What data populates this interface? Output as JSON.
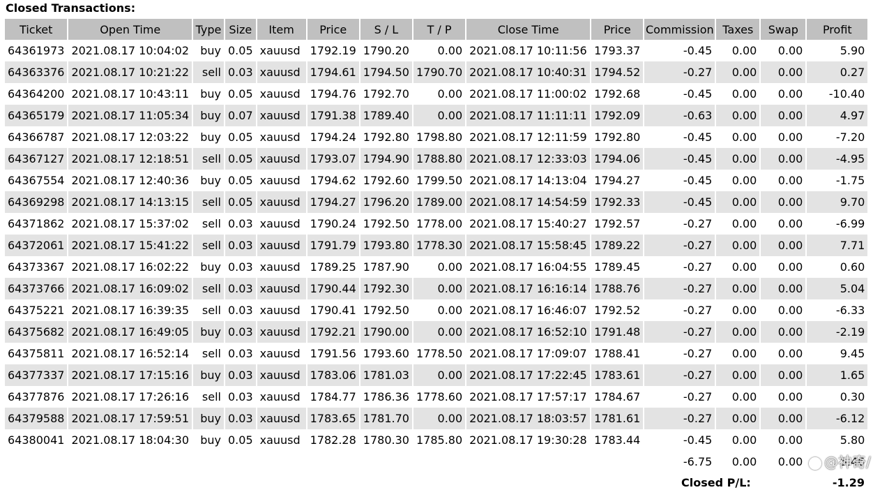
{
  "section_title": "Closed Transactions:",
  "columns": [
    "Ticket",
    "Open Time",
    "Type",
    "Size",
    "Item",
    "Price",
    "S / L",
    "T / P",
    "Close Time",
    "Price",
    "Commission",
    "Taxes",
    "Swap",
    "Profit"
  ],
  "rows": [
    [
      "64361973",
      "2021.08.17 10:04:02",
      "buy",
      "0.05",
      "xauusd",
      "1792.19",
      "1790.20",
      "0.00",
      "2021.08.17 10:11:56",
      "1793.37",
      "-0.45",
      "0.00",
      "0.00",
      "5.90"
    ],
    [
      "64363376",
      "2021.08.17 10:21:22",
      "sell",
      "0.03",
      "xauusd",
      "1794.61",
      "1794.50",
      "1790.70",
      "2021.08.17 10:40:31",
      "1794.52",
      "-0.27",
      "0.00",
      "0.00",
      "0.27"
    ],
    [
      "64364200",
      "2021.08.17 10:43:11",
      "buy",
      "0.05",
      "xauusd",
      "1794.76",
      "1792.70",
      "0.00",
      "2021.08.17 11:00:02",
      "1792.68",
      "-0.45",
      "0.00",
      "0.00",
      "-10.40"
    ],
    [
      "64365179",
      "2021.08.17 11:05:34",
      "buy",
      "0.07",
      "xauusd",
      "1791.38",
      "1789.40",
      "0.00",
      "2021.08.17 11:11:11",
      "1792.09",
      "-0.63",
      "0.00",
      "0.00",
      "4.97"
    ],
    [
      "64366787",
      "2021.08.17 12:03:22",
      "buy",
      "0.05",
      "xauusd",
      "1794.24",
      "1792.80",
      "1798.80",
      "2021.08.17 12:11:59",
      "1792.80",
      "-0.45",
      "0.00",
      "0.00",
      "-7.20"
    ],
    [
      "64367127",
      "2021.08.17 12:18:51",
      "sell",
      "0.05",
      "xauusd",
      "1793.07",
      "1794.90",
      "1788.80",
      "2021.08.17 12:33:03",
      "1794.06",
      "-0.45",
      "0.00",
      "0.00",
      "-4.95"
    ],
    [
      "64367554",
      "2021.08.17 12:40:36",
      "buy",
      "0.05",
      "xauusd",
      "1794.62",
      "1792.60",
      "1799.50",
      "2021.08.17 14:13:04",
      "1794.27",
      "-0.45",
      "0.00",
      "0.00",
      "-1.75"
    ],
    [
      "64369298",
      "2021.08.17 14:13:15",
      "sell",
      "0.05",
      "xauusd",
      "1794.27",
      "1796.20",
      "1789.00",
      "2021.08.17 14:54:59",
      "1792.33",
      "-0.45",
      "0.00",
      "0.00",
      "9.70"
    ],
    [
      "64371862",
      "2021.08.17 15:37:02",
      "sell",
      "0.03",
      "xauusd",
      "1790.24",
      "1792.50",
      "1778.00",
      "2021.08.17 15:40:27",
      "1792.57",
      "-0.27",
      "0.00",
      "0.00",
      "-6.99"
    ],
    [
      "64372061",
      "2021.08.17 15:41:22",
      "sell",
      "0.03",
      "xauusd",
      "1791.79",
      "1793.80",
      "1778.30",
      "2021.08.17 15:58:45",
      "1789.22",
      "-0.27",
      "0.00",
      "0.00",
      "7.71"
    ],
    [
      "64373367",
      "2021.08.17 16:02:22",
      "buy",
      "0.03",
      "xauusd",
      "1789.25",
      "1787.90",
      "0.00",
      "2021.08.17 16:04:55",
      "1789.45",
      "-0.27",
      "0.00",
      "0.00",
      "0.60"
    ],
    [
      "64373766",
      "2021.08.17 16:09:02",
      "sell",
      "0.03",
      "xauusd",
      "1790.44",
      "1792.30",
      "0.00",
      "2021.08.17 16:16:14",
      "1788.76",
      "-0.27",
      "0.00",
      "0.00",
      "5.04"
    ],
    [
      "64375221",
      "2021.08.17 16:39:35",
      "sell",
      "0.03",
      "xauusd",
      "1790.41",
      "1792.50",
      "0.00",
      "2021.08.17 16:46:07",
      "1792.52",
      "-0.27",
      "0.00",
      "0.00",
      "-6.33"
    ],
    [
      "64375682",
      "2021.08.17 16:49:05",
      "buy",
      "0.03",
      "xauusd",
      "1792.21",
      "1790.00",
      "0.00",
      "2021.08.17 16:52:10",
      "1791.48",
      "-0.27",
      "0.00",
      "0.00",
      "-2.19"
    ],
    [
      "64375811",
      "2021.08.17 16:52:14",
      "sell",
      "0.03",
      "xauusd",
      "1791.56",
      "1793.60",
      "1778.50",
      "2021.08.17 17:09:07",
      "1788.41",
      "-0.27",
      "0.00",
      "0.00",
      "9.45"
    ],
    [
      "64377337",
      "2021.08.17 17:15:16",
      "buy",
      "0.03",
      "xauusd",
      "1783.06",
      "1781.03",
      "0.00",
      "2021.08.17 17:22:45",
      "1783.61",
      "-0.27",
      "0.00",
      "0.00",
      "1.65"
    ],
    [
      "64377876",
      "2021.08.17 17:26:16",
      "sell",
      "0.03",
      "xauusd",
      "1784.77",
      "1786.36",
      "1778.60",
      "2021.08.17 17:57:17",
      "1784.67",
      "-0.27",
      "0.00",
      "0.00",
      "0.30"
    ],
    [
      "64379588",
      "2021.08.17 17:59:51",
      "buy",
      "0.03",
      "xauusd",
      "1783.65",
      "1781.70",
      "0.00",
      "2021.08.17 18:03:57",
      "1781.61",
      "-0.27",
      "0.00",
      "0.00",
      "-6.12"
    ],
    [
      "64380041",
      "2021.08.17 18:04:30",
      "buy",
      "0.05",
      "xauusd",
      "1782.28",
      "1780.30",
      "1785.80",
      "2021.08.17 19:30:28",
      "1783.44",
      "-0.45",
      "0.00",
      "0.00",
      "5.80"
    ]
  ],
  "totals": {
    "commission": "-6.75",
    "taxes": "0.00",
    "swap": "0.00",
    "profit": "5.46"
  },
  "closed_pl": {
    "label": "Closed P/L:",
    "value": "-1.29"
  },
  "watermark": {
    "icon": "weibo-logo-icon",
    "text": "@神奇/"
  },
  "colors": {
    "header_bg": "#c0c0c0",
    "stripe_bg": "#e3e3e3",
    "row_bg": "#ffffff"
  }
}
